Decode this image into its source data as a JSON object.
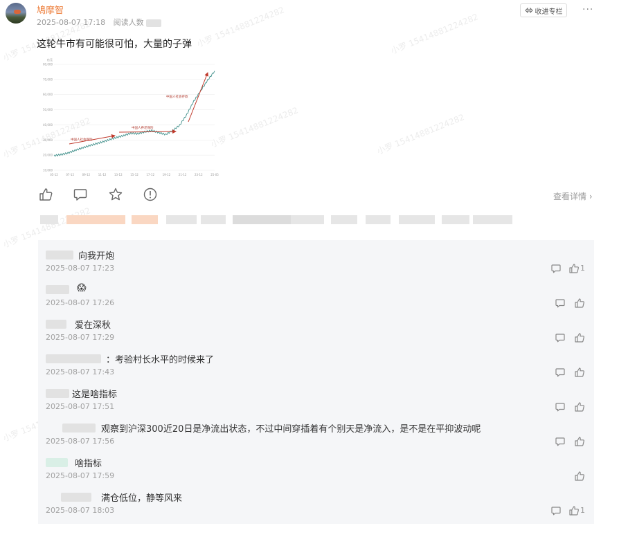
{
  "post": {
    "author": "鳩摩智",
    "time": "2025-08-07 17:18",
    "read_label": "阅读人数",
    "collect_label": "收进专栏",
    "more_label": "···",
    "title": "这轮牛市有可能很可怕，大量的子弹",
    "view_detail": "查看详情",
    "icons": [
      "thumbs-up-icon",
      "comment-icon",
      "star-icon",
      "report-icon"
    ]
  },
  "watermark": "小罗 15414881224282",
  "chart_data": {
    "type": "line",
    "title": "",
    "ylabel": "亿元",
    "y_ticks": [
      "800,000",
      "770,000",
      "660,000",
      "550,000",
      "440,000",
      "330,000",
      "220,000",
      "110,000"
    ],
    "x_ticks": [
      "05-12",
      "07-12",
      "09-12",
      "11-12",
      "13-12",
      "15-12",
      "17-12",
      "19-12",
      "21-12",
      "23-12",
      "25-05"
    ],
    "ylim": [
      0,
      800000
    ],
    "annotations": [
      "中国人社会保险",
      "中国人养老保险",
      "中国人社会存款"
    ],
    "series": [
      {
        "values": [
          110000,
          118000,
          130000,
          150000,
          168000,
          185000,
          200000,
          215000,
          232000,
          248000,
          262000,
          280000,
          276000,
          290000,
          300000,
          285000,
          270000,
          300000,
          340000,
          420000,
          520000,
          600000,
          680000,
          750000
        ]
      }
    ]
  },
  "comments": [
    {
      "text": "向我开炮",
      "time": "2025-08-07 17:23",
      "likes": "1"
    },
    {
      "text": "😱",
      "time": "2025-08-07 17:26",
      "likes": ""
    },
    {
      "text": "爱在深秋",
      "time": "2025-08-07 17:29",
      "likes": ""
    },
    {
      "text": "：考验村长水平的时候来了",
      "time": "2025-08-07 17:43",
      "likes": ""
    },
    {
      "text": "这是啥指标",
      "time": "2025-08-07 17:51",
      "likes": ""
    },
    {
      "text": "观察到沪深300近20日是净流出状态，不过中间穿插着有个别天是净流入，是不是在平抑波动呢",
      "time": "2025-08-07 17:56",
      "likes": ""
    },
    {
      "text": "啥指标",
      "time": "2025-08-07 17:59",
      "likes": ""
    },
    {
      "text": "满仓低位，静等风来",
      "time": "2025-08-07 18:03",
      "likes": "1"
    }
  ]
}
